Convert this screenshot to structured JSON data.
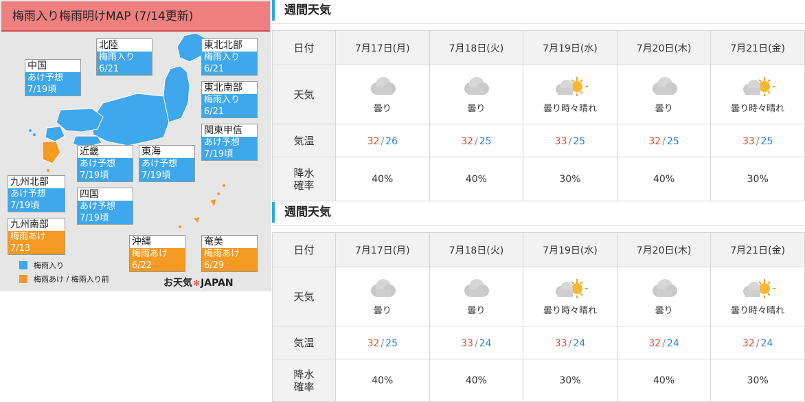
{
  "map": {
    "title": "梅雨入り梅雨明けMAP (7/14更新)",
    "regions": [
      {
        "key": "chugoku",
        "name": "中国",
        "status": "あけ予想",
        "date": "7/19頃",
        "color": "blue"
      },
      {
        "key": "hokuriku",
        "name": "北陸",
        "status": "梅雨入り",
        "date": "6/21",
        "color": "blue"
      },
      {
        "key": "tohoku-hokubu",
        "name": "東北北部",
        "status": "梅雨入り",
        "date": "6/21",
        "color": "blue"
      },
      {
        "key": "tohoku-nanbu",
        "name": "東北南部",
        "status": "梅雨入り",
        "date": "6/21",
        "color": "blue"
      },
      {
        "key": "kanto-koshin",
        "name": "関東甲信",
        "status": "あけ予想",
        "date": "7/19頃",
        "color": "blue"
      },
      {
        "key": "kinki",
        "name": "近畿",
        "status": "あけ予想",
        "date": "7/19頃",
        "color": "blue"
      },
      {
        "key": "tokai",
        "name": "東海",
        "status": "あけ予想",
        "date": "7/19頃",
        "color": "blue"
      },
      {
        "key": "kyushu-hokubu",
        "name": "九州北部",
        "status": "あけ予想",
        "date": "7/19頃",
        "color": "blue"
      },
      {
        "key": "shikoku",
        "name": "四国",
        "status": "あけ予想",
        "date": "7/19頃",
        "color": "blue"
      },
      {
        "key": "kyushu-nanbu",
        "name": "九州南部",
        "status": "梅雨あけ",
        "date": "7/13",
        "color": "orange"
      },
      {
        "key": "okinawa",
        "name": "沖縄",
        "status": "梅雨あけ",
        "date": "6/22",
        "color": "orange"
      },
      {
        "key": "amami",
        "name": "奄美",
        "status": "梅雨あけ",
        "date": "6/29",
        "color": "orange"
      }
    ],
    "legend": [
      {
        "label": "梅雨入り",
        "color": "#3fa7ec"
      },
      {
        "label": "梅雨あけ / 梅雨入り前",
        "color": "#f59a23"
      }
    ],
    "logo": {
      "pre": "お天気",
      "star": "✻",
      "post": "JAPAN"
    }
  },
  "weekly": [
    {
      "heading": "週間天気",
      "labels": {
        "date": "日付",
        "weather": "天気",
        "temp": "気温",
        "rain": "降水確率"
      },
      "days": [
        {
          "date": "7月17日(月)",
          "icon": "cloud-icon",
          "weather": "曇り",
          "high": "32",
          "low": "26",
          "rain": "40%"
        },
        {
          "date": "7月18日(火)",
          "icon": "cloud-icon",
          "weather": "曇り",
          "high": "32",
          "low": "25",
          "rain": "40%"
        },
        {
          "date": "7月19日(水)",
          "icon": "cloud-sun-icon",
          "weather": "曇り時々晴れ",
          "high": "33",
          "low": "25",
          "rain": "30%"
        },
        {
          "date": "7月20日(木)",
          "icon": "cloud-icon",
          "weather": "曇り",
          "high": "32",
          "low": "25",
          "rain": "40%"
        },
        {
          "date": "7月21日(金)",
          "icon": "cloud-sun-icon",
          "weather": "曇り時々晴れ",
          "high": "33",
          "low": "25",
          "rain": "30%"
        }
      ]
    },
    {
      "heading": "週間天気",
      "labels": {
        "date": "日付",
        "weather": "天気",
        "temp": "気温",
        "rain": "降水確率"
      },
      "days": [
        {
          "date": "7月17日(月)",
          "icon": "cloud-icon",
          "weather": "曇り",
          "high": "32",
          "low": "25",
          "rain": "40%"
        },
        {
          "date": "7月18日(火)",
          "icon": "cloud-icon",
          "weather": "曇り",
          "high": "33",
          "low": "24",
          "rain": "40%"
        },
        {
          "date": "7月19日(水)",
          "icon": "cloud-sun-icon",
          "weather": "曇り時々晴れ",
          "high": "33",
          "low": "24",
          "rain": "30%"
        },
        {
          "date": "7月20日(木)",
          "icon": "cloud-icon",
          "weather": "曇り",
          "high": "32",
          "low": "24",
          "rain": "40%"
        },
        {
          "date": "7月21日(金)",
          "icon": "cloud-sun-icon",
          "weather": "曇り時々晴れ",
          "high": "32",
          "low": "24",
          "rain": "30%"
        }
      ]
    }
  ]
}
